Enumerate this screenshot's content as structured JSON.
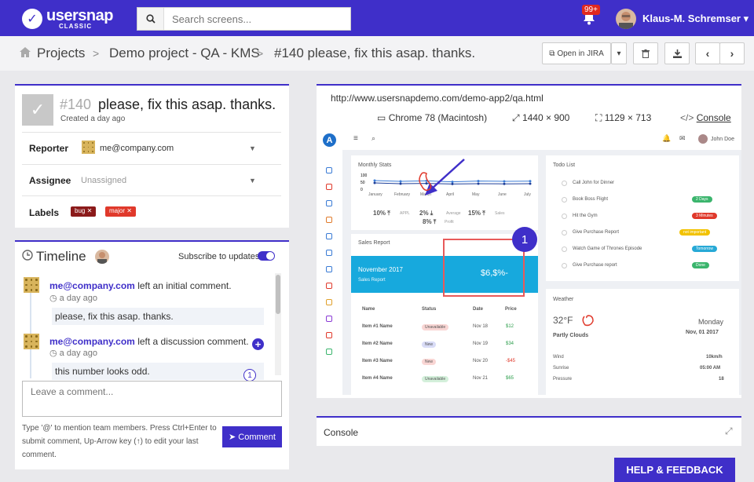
{
  "header": {
    "logo_main": "usersnap",
    "logo_sub": "CLASSIC",
    "search_placeholder": "Search screens...",
    "notif_badge": "99+",
    "username": "Klaus-M. Schremser"
  },
  "breadcrumb": {
    "items": [
      "Projects",
      "Demo project - QA - KMS",
      "#140 please, fix this asap. thanks."
    ],
    "sep": ">"
  },
  "toolbar": {
    "open_jira": "Open in JIRA"
  },
  "issue": {
    "number": "#140",
    "title": "please, fix this asap. thanks.",
    "created": "Created a day ago",
    "reporter_label": "Reporter",
    "reporter": "me@company.com",
    "assignee_label": "Assignee",
    "assignee": "Unassigned",
    "labels_label": "Labels",
    "labels": [
      {
        "text": "bug",
        "color": "#8b1a1a"
      },
      {
        "text": "major",
        "color": "#e0392b"
      }
    ]
  },
  "timeline": {
    "title": "Timeline",
    "subscribe": "Subscribe to updates",
    "entries": [
      {
        "user": "me@company.com",
        "action": "left an initial comment.",
        "time": "a day ago",
        "comment": "please, fix this asap. thanks."
      },
      {
        "user": "me@company.com",
        "action": "left a discussion comment.",
        "time": "a day ago",
        "comment": "this number looks odd.",
        "pin": "1"
      }
    ],
    "placeholder": "Leave a comment...",
    "hint": "Type '@' to mention team members. Press Ctrl+Enter to submit comment, Up-Arrow key (↑) to edit your last comment.",
    "submit": "Comment"
  },
  "screen": {
    "url": "http://www.usersnapdemo.com/demo-app2/qa.html",
    "browser": "Chrome 78 (Macintosh)",
    "resolution": "1440 × 900",
    "viewport": "1129 × 713",
    "console_link": "Console"
  },
  "demo": {
    "user": "John Doe",
    "monthly_stats": "Monthly Stats",
    "months": [
      "January",
      "February",
      "March",
      "April",
      "May",
      "June",
      "July"
    ],
    "y_ticks": [
      "100",
      "50",
      "0"
    ],
    "stats": [
      {
        "v": "10%",
        "l": "APPL"
      },
      {
        "v": "2%",
        "l": "Average"
      },
      {
        "v": "15%",
        "l": "Sales"
      },
      {
        "v": "8%",
        "l": "Profit"
      }
    ],
    "sales_report": "Sales Report",
    "month": "November 2017",
    "sales_sub": "Sales Report",
    "amount": "$6,$%-",
    "pin": "1",
    "table_headers": [
      "Name",
      "Status",
      "Date",
      "Price"
    ],
    "rows": [
      {
        "name": "Item #1 Name",
        "status": "Unavailable",
        "scolor": "#f9d6d4",
        "date": "Nov 18",
        "price": "$12",
        "pcolor": "#2a9d4a"
      },
      {
        "name": "Item #2 Name",
        "status": "New",
        "scolor": "#d9dcf7",
        "date": "Nov 19",
        "price": "$34",
        "pcolor": "#2a9d4a"
      },
      {
        "name": "Item #3 Name",
        "status": "New",
        "scolor": "#f9d6d4",
        "date": "Nov 20",
        "price": "-$45",
        "pcolor": "#e0392b"
      },
      {
        "name": "Item #4 Name",
        "status": "Unavailable",
        "scolor": "#d4f0db",
        "date": "Nov 21",
        "price": "$65",
        "pcolor": "#2a9d4a"
      }
    ],
    "todo_title": "Todo List",
    "todos": [
      {
        "t": "Call John for Dinner",
        "b": "",
        "c": ""
      },
      {
        "t": "Book Boss Flight",
        "b": "2 Days",
        "c": "#3bb56d"
      },
      {
        "t": "Hit the Gym",
        "b": "3 Minutes",
        "c": "#e0392b"
      },
      {
        "t": "Give Purchase Report",
        "b": "not important",
        "c": "#f2c200"
      },
      {
        "t": "Watch Game of Thrones Episode",
        "b": "Tomorrow",
        "c": "#27a9d6"
      },
      {
        "t": "Give Purchase report",
        "b": "Done",
        "c": "#3bb56d"
      }
    ],
    "weather": {
      "title": "Weather",
      "temp": "32°F",
      "desc": "Partly Clouds",
      "day": "Monday",
      "date": "Nov, 01 2017",
      "rows": [
        {
          "k": "Wind",
          "v": "10km/h"
        },
        {
          "k": "Sunrise",
          "v": "05:00 AM"
        },
        {
          "k": "Pressure",
          "v": "18"
        }
      ]
    }
  },
  "console_panel": {
    "title": "Console"
  },
  "help": "HELP & FEEDBACK",
  "chart_data": {
    "type": "line",
    "categories": [
      "January",
      "February",
      "March",
      "April",
      "May",
      "June",
      "July"
    ],
    "series": [
      {
        "values": [
          60,
          55,
          58,
          52,
          57,
          55,
          56
        ]
      },
      {
        "values": [
          45,
          40,
          42,
          38,
          40,
          39,
          40
        ]
      }
    ],
    "ylim": [
      0,
      100
    ]
  }
}
